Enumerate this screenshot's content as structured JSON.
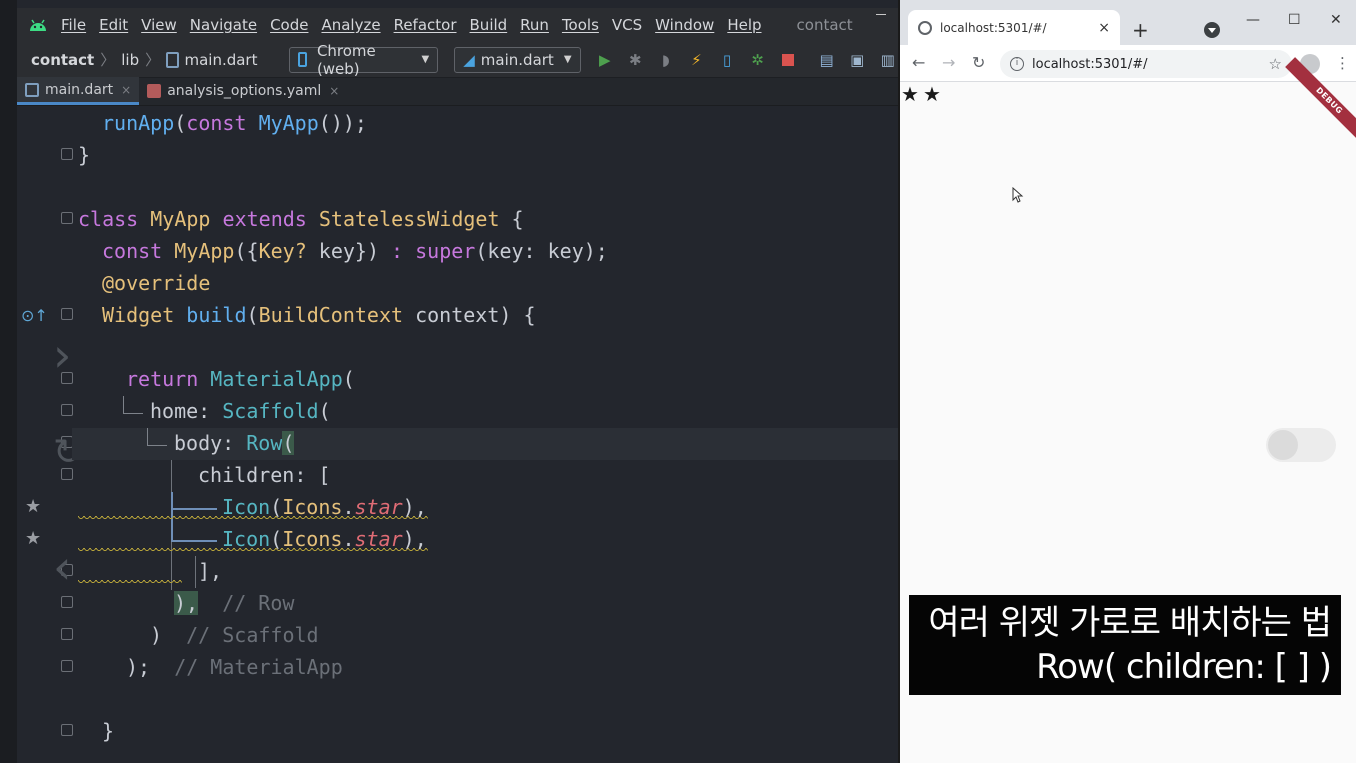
{
  "ide": {
    "menu": [
      "File",
      "Edit",
      "View",
      "Navigate",
      "Code",
      "Analyze",
      "Refactor",
      "Build",
      "Run",
      "Tools",
      "VCS",
      "Window",
      "Help"
    ],
    "project_label": "contact",
    "breadcrumb": {
      "project": "contact",
      "folder": "lib",
      "file": "main.dart"
    },
    "device_selector": "Chrome (web)",
    "config_selector": "main.dart",
    "tabs": [
      {
        "label": "main.dart",
        "active": true
      },
      {
        "label": "analysis_options.yaml",
        "active": false
      }
    ],
    "tab_close_glyph": "×",
    "code": {
      "l1": {
        "call": "runApp",
        "open": "(",
        "kw": "const",
        "cls": "MyApp",
        "close": "());"
      },
      "l2": "}",
      "l4": {
        "kw1": "class",
        "name": "MyApp",
        "kw2": "extends",
        "base": "StatelessWidget",
        "brace": " {"
      },
      "l5": {
        "kw": "const",
        "name": "MyApp",
        "p1": "({",
        "type": "Key?",
        "p2": " key}) ",
        "colon": ":",
        "sp": " ",
        "sup": "super",
        "p3": "(key: key);"
      },
      "l6": "@override",
      "l7": {
        "type": "Widget",
        "sp": " ",
        "name": "build",
        "p1": "(",
        "ctx": "BuildContext",
        "p2": " context) {"
      },
      "l9": {
        "kw": "return",
        "sp": " ",
        "cls": "MaterialApp",
        "p": "("
      },
      "l10": {
        "key": "home: ",
        "cls": "Scaffold",
        "p": "("
      },
      "l11": {
        "key": "body: ",
        "cls": "Row",
        "p": "("
      },
      "l12": {
        "key": "children: ",
        "p": "["
      },
      "l13": {
        "cls": "Icon",
        "p1": "(",
        "icons": "Icons",
        "dot": ".",
        "star": "star",
        "p2": "),"
      },
      "l14": {
        "cls": "Icon",
        "p1": "(",
        "icons": "Icons",
        "dot": ".",
        "star": "star",
        "p2": "),"
      },
      "l15": "],",
      "l16": {
        "p": "),",
        "comment": "// Row"
      },
      "l17": {
        "p": ")",
        "comment": "// Scaffold"
      },
      "l18": {
        "p": ");",
        "comment": "// MaterialApp"
      },
      "l20": "}"
    },
    "gutter_star_glyph": "★",
    "override_glyph": "⊙↑"
  },
  "browser": {
    "tab_title": "localhost:5301/#/",
    "tab_close_glyph": "×",
    "new_tab_glyph": "+",
    "window_controls": [
      "—",
      "☐",
      "✕"
    ],
    "nav": {
      "back": "←",
      "forward": "→",
      "reload": "↻"
    },
    "url": "localhost:5301/#/",
    "info_glyph": "i",
    "bookmark_glyph": "☆",
    "menu_glyph": "⋮",
    "debug_banner": "DEBUG",
    "app_stars": [
      "★",
      "★"
    ]
  },
  "caption": {
    "line1": "여러 위젯 가로로 배치하는 법",
    "line2": "Row(  children: [ ] )"
  },
  "colors": {
    "ide_bg": "#23262d",
    "keyword": "#c678dd",
    "function": "#61afef",
    "class": "#e5c07b",
    "comment": "#6b7078",
    "debug_banner": "#a3303f"
  }
}
